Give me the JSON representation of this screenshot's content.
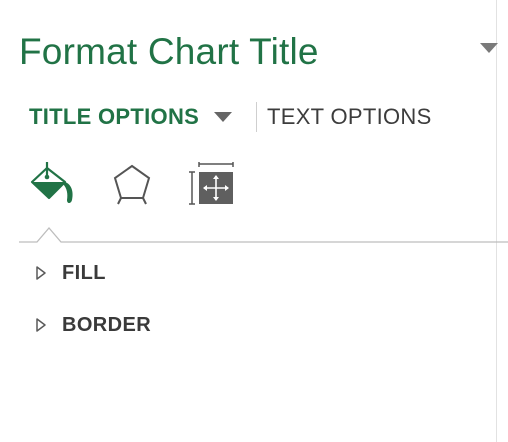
{
  "pane": {
    "title": "Format Chart Title",
    "menu_icon": "chevron-down-icon"
  },
  "tabs": {
    "title_options": {
      "label": "TITLE OPTIONS",
      "selected": true
    },
    "text_options": {
      "label": "TEXT OPTIONS",
      "selected": false
    }
  },
  "icon_tabs": [
    {
      "name": "fill-line-icon",
      "selected": true
    },
    {
      "name": "effects-icon",
      "selected": false
    },
    {
      "name": "size-properties-icon",
      "selected": false
    }
  ],
  "sections": {
    "fill": {
      "label": "FILL",
      "expanded": false
    },
    "border": {
      "label": "BORDER",
      "expanded": false
    }
  },
  "colors": {
    "accent": "#217346",
    "text": "#3a3a3a",
    "icon_gray": "#595959"
  }
}
